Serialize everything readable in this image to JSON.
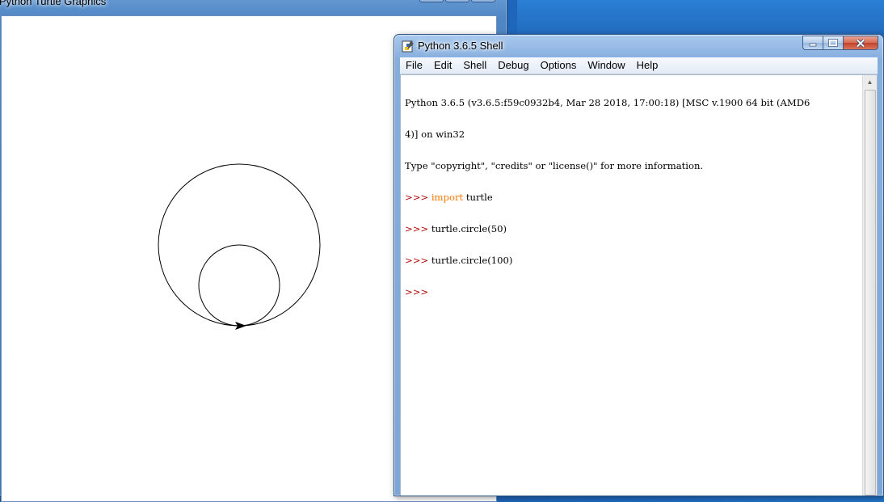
{
  "turtle_window": {
    "title": "Python Turtle Graphics",
    "drawing": {
      "stroke_color": "#000000",
      "circles": [
        {
          "command": "turtle.circle(50)",
          "radius": 50
        },
        {
          "command": "turtle.circle(100)",
          "radius": 100
        }
      ],
      "turtle_heading": "east"
    }
  },
  "shell_window": {
    "title": "Python 3.6.5 Shell",
    "controls": {
      "minimize": "minimize",
      "maximize": "maximize",
      "close": "close"
    },
    "menu": [
      "File",
      "Edit",
      "Shell",
      "Debug",
      "Options",
      "Window",
      "Help"
    ],
    "console": {
      "banner_line1": "Python 3.6.5 (v3.6.5:f59c0932b4, Mar 28 2018, 17:00:18) [MSC v.1900 64 bit (AMD6",
      "banner_line2": "4)] on win32",
      "banner_line3": "Type \"copyright\", \"credits\" or \"license()\" for more information.",
      "prompt": ">>>",
      "cmd1_keyword": "import",
      "cmd1_rest": " turtle",
      "cmd2": " turtle.circle(50)",
      "cmd3": " turtle.circle(100)",
      "colors": {
        "prompt": "#b00000",
        "keyword": "#ff7700",
        "text": "#000000"
      }
    }
  }
}
